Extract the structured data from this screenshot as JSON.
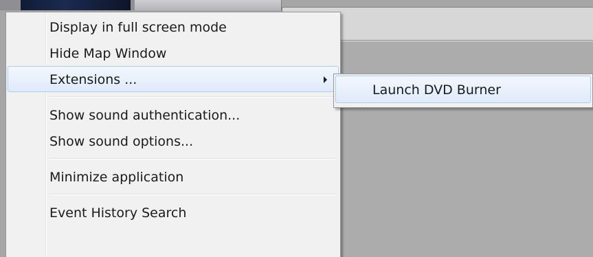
{
  "context_menu": {
    "items": [
      {
        "label": "Display in full screen mode"
      },
      {
        "label": "Hide Map Window"
      },
      {
        "label": "Extensions ..."
      },
      {
        "label": "Show sound authentication..."
      },
      {
        "label": "Show sound options..."
      },
      {
        "label": "Minimize application"
      },
      {
        "label": "Event History Search"
      }
    ]
  },
  "submenu": {
    "items": [
      {
        "label": "Launch DVD Burner"
      }
    ]
  },
  "colors": {
    "highlight_border": "#aeccf2",
    "menu_background": "#f1f1f1"
  }
}
